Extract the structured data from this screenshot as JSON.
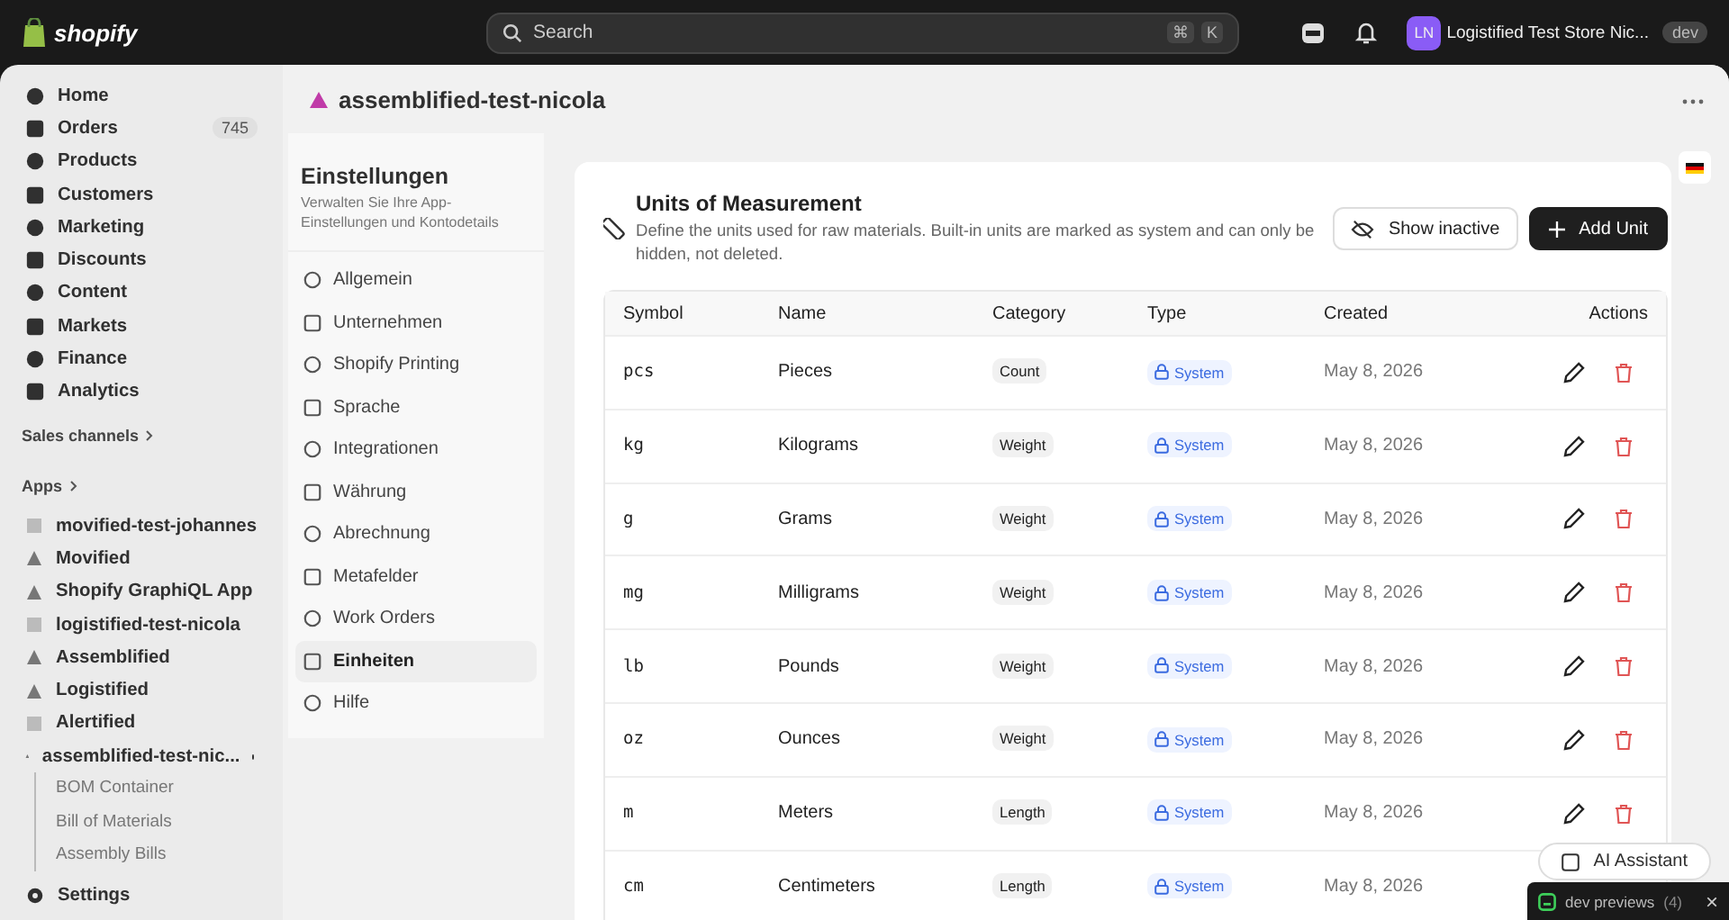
{
  "topbar": {
    "logo": "shopify",
    "search": {
      "placeholder": "Search",
      "keys": [
        "⌘",
        "K"
      ]
    },
    "store": {
      "initials": "LN",
      "name": "Logistified Test Store Nic...",
      "badge": "dev"
    }
  },
  "sidebar": {
    "items": [
      {
        "label": "Home",
        "selected": false
      },
      {
        "label": "Orders",
        "count": "745",
        "selected": false
      },
      {
        "label": "Products",
        "selected": false
      },
      {
        "label": "Customers",
        "selected": false
      },
      {
        "label": "Marketing",
        "selected": false
      },
      {
        "label": "Discounts",
        "selected": false
      },
      {
        "label": "Content",
        "selected": false
      },
      {
        "label": "Markets",
        "selected": false
      },
      {
        "label": "Finance",
        "selected": false
      },
      {
        "label": "Analytics",
        "selected": false
      }
    ],
    "sales_channels": "Sales channels",
    "apps_heading": "Apps",
    "apps": [
      {
        "label": "movified-test-johannes",
        "pinned": false
      },
      {
        "label": "Movified",
        "pinned": false
      },
      {
        "label": "Shopify GraphiQL App",
        "pinned": false
      },
      {
        "label": "logistified-test-nicola",
        "pinned": false
      },
      {
        "label": "Assemblified",
        "pinned": false
      },
      {
        "label": "Logistified",
        "pinned": false
      },
      {
        "label": "Alertified",
        "pinned": false
      },
      {
        "label": "assemblified-test-nic...",
        "pinned": true,
        "children": [
          {
            "label": "BOM Container"
          },
          {
            "label": "Bill of Materials"
          },
          {
            "label": "Assembly Bills"
          }
        ]
      }
    ],
    "settings": "Settings"
  },
  "page": {
    "title": "assemblified-test-nicola"
  },
  "settings_panel": {
    "title": "Einstellungen",
    "subtitle": "Verwalten Sie Ihre App-Einstellungen und Kontodetails",
    "items": [
      {
        "label": "Allgemein",
        "selected": false
      },
      {
        "label": "Unternehmen",
        "selected": false
      },
      {
        "label": "Shopify Printing",
        "selected": false
      },
      {
        "label": "Sprache",
        "selected": false
      },
      {
        "label": "Integrationen",
        "selected": false
      },
      {
        "label": "Währung",
        "selected": false
      },
      {
        "label": "Abrechnung",
        "selected": false
      },
      {
        "label": "Metafelder",
        "selected": false
      },
      {
        "label": "Work Orders",
        "selected": false
      },
      {
        "label": "Einheiten",
        "selected": true
      },
      {
        "label": "Hilfe",
        "selected": false
      }
    ]
  },
  "units": {
    "title": "Units of Measurement",
    "description": "Define the units used for raw materials. Built-in units are marked as system and can only be hidden, not deleted.",
    "buttons": [
      "Show inactive",
      "Add Unit"
    ],
    "table": {
      "columns": [
        "Symbol",
        "Name",
        "Category",
        "Type",
        "Created",
        "Actions"
      ],
      "rows": [
        {
          "symbol": "pcs",
          "name": "Pieces",
          "category": "Count",
          "type": "System",
          "created": "May 8, 2026"
        },
        {
          "symbol": "kg",
          "name": "Kilograms",
          "category": "Weight",
          "type": "System",
          "created": "May 8, 2026"
        },
        {
          "symbol": "g",
          "name": "Grams",
          "category": "Weight",
          "type": "System",
          "created": "May 8, 2026"
        },
        {
          "symbol": "mg",
          "name": "Milligrams",
          "category": "Weight",
          "type": "System",
          "created": "May 8, 2026"
        },
        {
          "symbol": "lb",
          "name": "Pounds",
          "category": "Weight",
          "type": "System",
          "created": "May 8, 2026"
        },
        {
          "symbol": "oz",
          "name": "Ounces",
          "category": "Weight",
          "type": "System",
          "created": "May 8, 2026"
        },
        {
          "symbol": "m",
          "name": "Meters",
          "category": "Length",
          "type": "System",
          "created": "May 8, 2026"
        },
        {
          "symbol": "cm",
          "name": "Centimeters",
          "category": "Length",
          "type": "System",
          "created": "May 8, 2026"
        }
      ]
    }
  },
  "ai_assistant": "AI Assistant",
  "dev_previews": {
    "label": "dev previews",
    "count": "(4)",
    "close": "×"
  }
}
